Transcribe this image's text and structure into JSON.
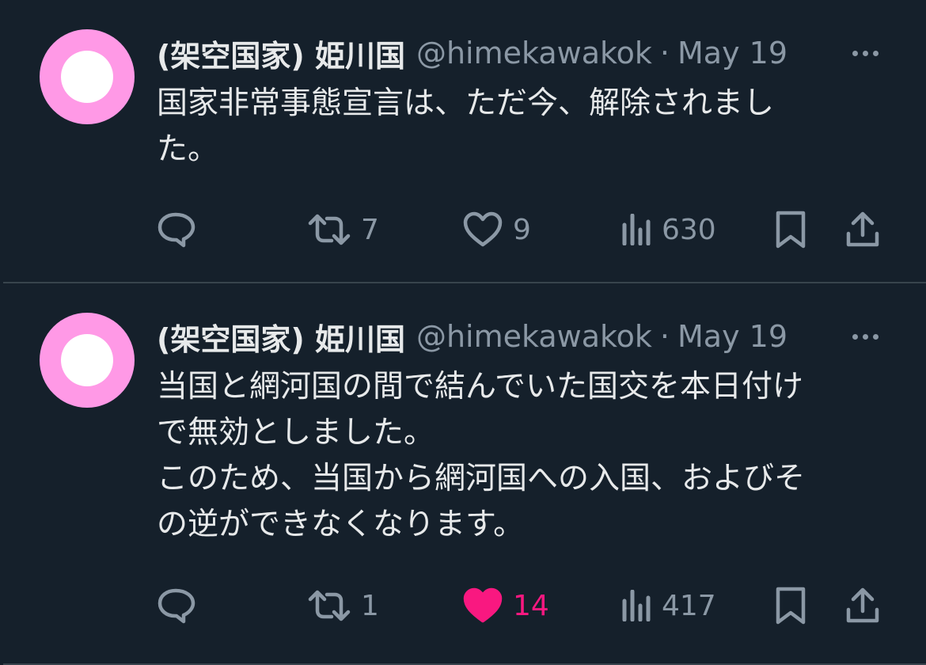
{
  "tweets": [
    {
      "author_name": "(架空国家) 姫川国",
      "handle": "@himekawakok",
      "separator": "·",
      "date": "May 19",
      "lines": [
        "国家非常事態宣言は、ただ今、解除されまし",
        "た。"
      ],
      "replies": "",
      "retweets": "7",
      "likes": "9",
      "views": "630",
      "liked": false
    },
    {
      "author_name": "(架空国家) 姫川国",
      "handle": "@himekawakok",
      "separator": "·",
      "date": "May 19",
      "lines": [
        "当国と網河国の間で結んでいた国交を本日付け",
        "で無効としました。",
        "このため、当国から網河国への入国、およびそ",
        "の逆ができなくなります。"
      ],
      "replies": "",
      "retweets": "1",
      "likes": "14",
      "views": "417",
      "liked": true
    }
  ],
  "colors": {
    "background": "#15202b",
    "avatar_ring": "#ff99e6",
    "like_active": "#f91880",
    "muted": "#8b98a5"
  },
  "icons": [
    "reply-icon",
    "retweet-icon",
    "heart-icon",
    "views-icon",
    "bookmark-icon",
    "share-icon",
    "more-icon"
  ]
}
